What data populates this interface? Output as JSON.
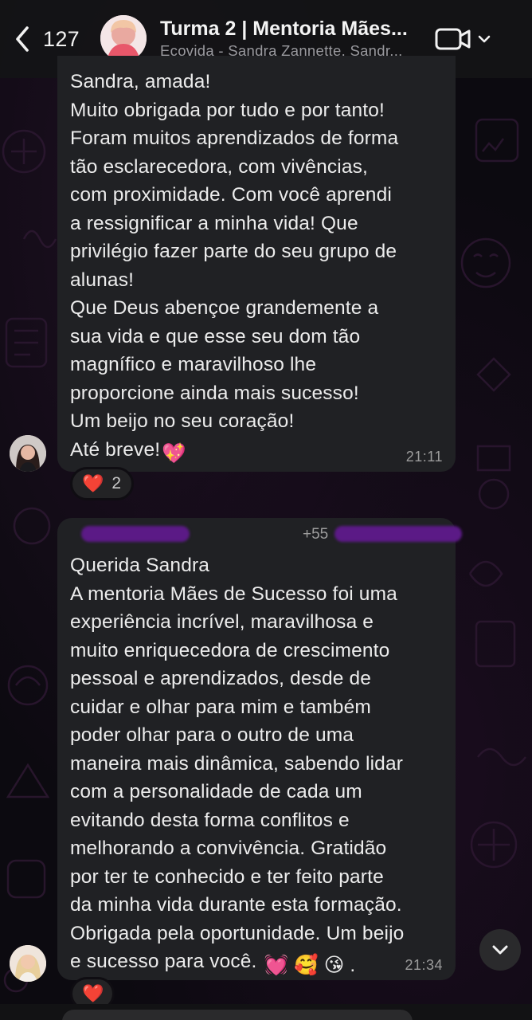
{
  "header": {
    "back_count": "127",
    "title": "Turma 2 | Mentoria Mães...",
    "subtitle": "Ecovida - Sandra Zannette, Sandr..."
  },
  "messages": [
    {
      "text": "Sandra, amada!\nMuito obrigada por tudo e por tanto!\nForam muitos aprendizados  de forma\ntão  esclarecedora, com vivências,\ncom proximidade. Com você  aprendi\na ressignificar a minha vida! Que\nprivilégio fazer parte do seu grupo de\nalunas!\nQue Deus abençoe grandemente a\nsua vida e que esse seu dom tão\nmagnífico e maravilhoso lhe\nproporcione ainda mais sucesso!\nUm beijo no seu coração!\nAté  breve!",
      "emoji": "💖",
      "time": "21:11",
      "reaction": {
        "emoji": "❤️",
        "count": "2"
      }
    },
    {
      "sender_phone": "+55",
      "text": "Querida Sandra\nA mentoria Mães de Sucesso foi uma\nexperiência incrível, maravilhosa e\nmuito enriquecedora de  crescimento\npessoal e aprendizados, desde de\ncuidar e olhar para mim e também\npoder olhar para o outro  de uma\nmaneira mais dinâmica, sabendo lidar\ncom a personalidade de cada um\nevitando desta forma  conflitos e\nmelhorando a convivência. Gratidão\npor ter te conhecido e ter feito parte\nda minha vida durante esta formação.\nObrigada pela oportunidade. Um beijo\ne sucesso para você.",
      "emojis": "💓 🥰 😘 .",
      "time": "21:34",
      "reaction": {
        "emoji": "❤️"
      }
    }
  ],
  "icons": {
    "back": "chevron-left-icon",
    "video": "video-camera-icon",
    "dropdown": "chevron-down-icon",
    "scroll_down": "chevron-down-icon"
  },
  "colors": {
    "bubble": "#202124",
    "background": "#0c0a10",
    "redaction": "#5b1a86",
    "heart": "#e0162b"
  }
}
